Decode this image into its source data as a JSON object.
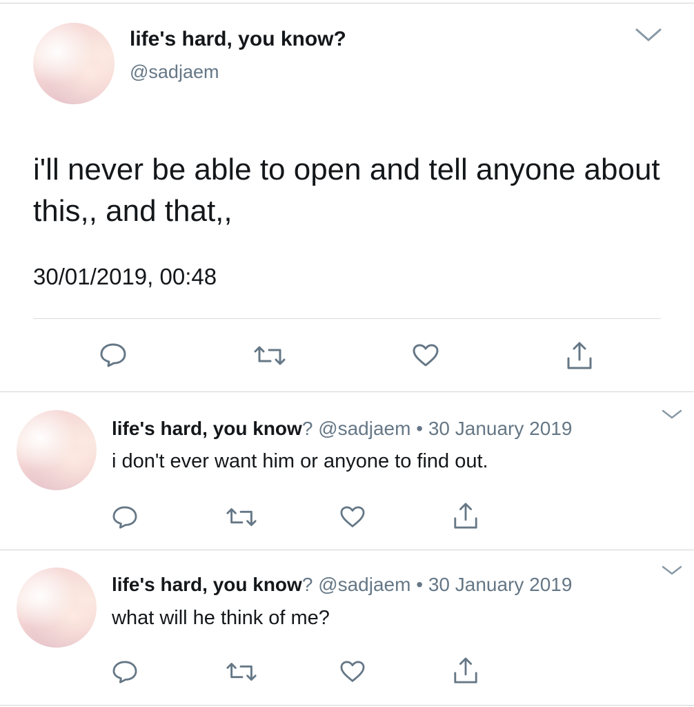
{
  "main_tweet": {
    "display_name": "life's hard, you know?",
    "handle": "@sadjaem",
    "text": "i'll never be able to open and tell anyone about this,, and that,,",
    "timestamp": "30/01/2019, 00:48"
  },
  "replies": [
    {
      "display_name": "life's hard, you know",
      "name_suffix": "?",
      "handle": "@sadjaem",
      "separator": "•",
      "date": "30 January 2019",
      "text": "i don't ever want him or anyone to find out."
    },
    {
      "display_name": "life's hard, you know",
      "name_suffix": "?",
      "handle": "@sadjaem",
      "separator": "•",
      "date": "30 January 2019",
      "text": "what will he think of me?"
    }
  ],
  "icons": [
    "reply-icon",
    "retweet-icon",
    "like-icon",
    "share-icon",
    "chevron-down-icon"
  ],
  "colors": {
    "text": "#14171a",
    "secondary": "#657786",
    "icon": "#657786",
    "divider": "#d0d3d6"
  }
}
